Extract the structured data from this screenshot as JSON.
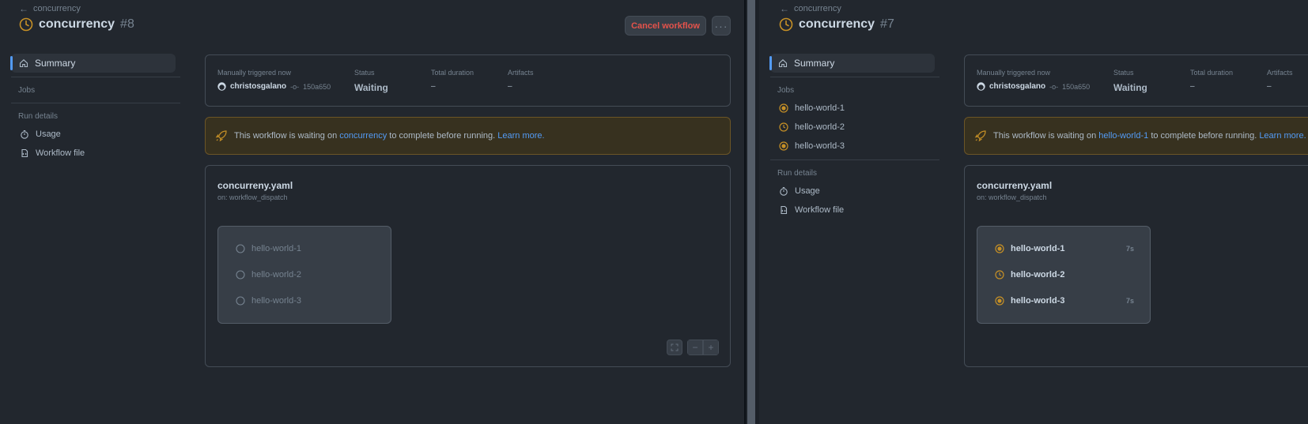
{
  "left": {
    "breadcrumb": "concurrency",
    "title": "concurrency",
    "run_number": "#8",
    "cancel_label": "Cancel workflow",
    "more_label": "···",
    "sidebar": {
      "summary": "Summary",
      "jobs_heading": "Jobs",
      "jobs": [],
      "run_details_heading": "Run details",
      "usage": "Usage",
      "workflow_file": "Workflow file"
    },
    "summary": {
      "trigger_label": "Manually triggered now",
      "user": "christosgalano",
      "sha": "150a650",
      "status_label": "Status",
      "status_value": "Waiting",
      "duration_label": "Total duration",
      "duration_value": "–",
      "artifacts_label": "Artifacts",
      "artifacts_value": "–"
    },
    "warning": {
      "prefix": "This workflow is waiting on",
      "link": "concurrency",
      "suffix": "to complete before running.",
      "learn_more": "Learn more."
    },
    "graph": {
      "file": "concurreny.yaml",
      "on": "on: workflow_dispatch",
      "jobs": [
        {
          "name": "hello-world-1",
          "time": ""
        },
        {
          "name": "hello-world-2",
          "time": ""
        },
        {
          "name": "hello-world-3",
          "time": ""
        }
      ]
    }
  },
  "right": {
    "breadcrumb": "concurrency",
    "title": "concurrency",
    "run_number": "#7",
    "sidebar": {
      "summary": "Summary",
      "jobs_heading": "Jobs",
      "jobs": [
        "hello-world-1",
        "hello-world-2",
        "hello-world-3"
      ],
      "run_details_heading": "Run details",
      "usage": "Usage",
      "workflow_file": "Workflow file"
    },
    "summary": {
      "trigger_label": "Manually triggered now",
      "user": "christosgalano",
      "sha": "150a650",
      "status_label": "Status",
      "status_value": "Waiting",
      "duration_label": "Total duration",
      "duration_value": "–",
      "artifacts_label": "Artifacts",
      "artifacts_value": "–"
    },
    "warning": {
      "prefix": "This workflow is waiting on",
      "link": "hello-world-1",
      "suffix": "to complete before running.",
      "learn_more": "Learn more."
    },
    "graph": {
      "file": "concurreny.yaml",
      "on": "on: workflow_dispatch",
      "jobs": [
        {
          "name": "hello-world-1",
          "time": "7s"
        },
        {
          "name": "hello-world-2",
          "time": ""
        },
        {
          "name": "hello-world-3",
          "time": "7s"
        }
      ]
    }
  },
  "colors": {
    "accent": "#539bf5",
    "pending": "#c69026",
    "danger": "#e5534b"
  }
}
